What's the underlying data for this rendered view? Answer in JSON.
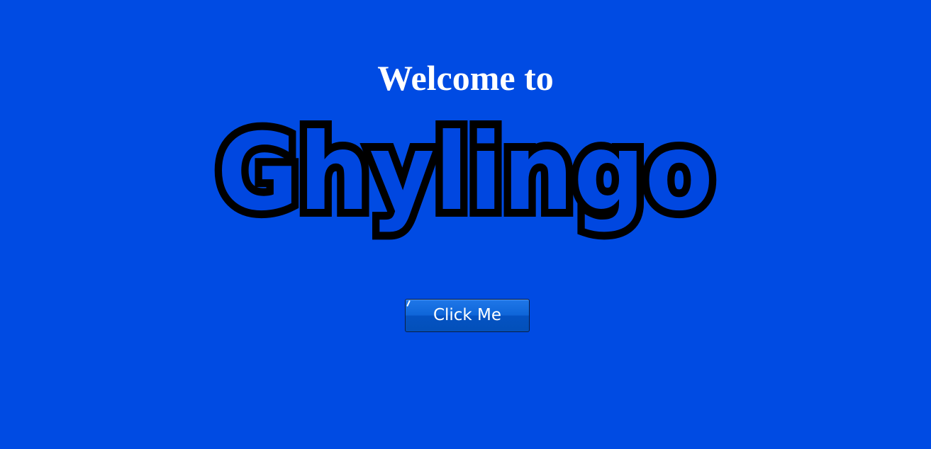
{
  "welcome_heading": "Welcome to",
  "logo": {
    "text": "Ghylingo",
    "fill_color": "#0047e0",
    "outline_color": "#000000"
  },
  "button": {
    "label": "Click Me"
  },
  "colors": {
    "background": "#004be3",
    "heading": "#ffffff",
    "button": "#0f66d9"
  }
}
